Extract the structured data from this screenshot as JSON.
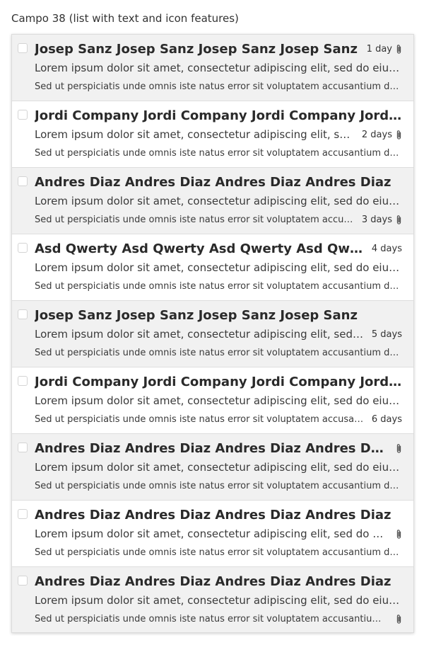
{
  "field": {
    "label": "Campo 38 (list with text and icon features)"
  },
  "icons": {
    "checkbox": "checkbox-icon",
    "attachment": "paperclip-icon"
  },
  "colors": {
    "shaded_row": "#f1f1f1",
    "plain_row": "#ffffff",
    "border": "#dcdcdc"
  },
  "items": [
    {
      "name": "Josep Sanz Josep Sanz Josep Sanz Josep Sanz",
      "text1": "Lorem ipsum dolor sit amet, consectetur adipiscing elit, sed do eiusmod tempor incididunt ut labore",
      "text2": "Sed ut perspiciatis unde omnis iste natus error sit voluptatem accusantium doloremque laudantium",
      "date": "1 day",
      "attachment": true,
      "meta_row": 1,
      "shaded": true
    },
    {
      "name": "Jordi Company Jordi Company Jordi Company Jordi Company",
      "text1": "Lorem ipsum dolor sit amet, consectetur adipiscing elit, sed do eiusmod tempor incididunt ut labore",
      "text2": "Sed ut perspiciatis unde omnis iste natus error sit voluptatem accusantium doloremque laudantium",
      "date": "2 days",
      "attachment": true,
      "meta_row": 2,
      "shaded": false
    },
    {
      "name": "Andres Diaz Andres Diaz Andres Diaz Andres Diaz",
      "text1": "Lorem ipsum dolor sit amet, consectetur adipiscing elit, sed do eiusmod tempor incididunt ut labore",
      "text2": "Sed ut perspiciatis unde omnis iste natus error sit voluptatem accusantium doloremque laudantium",
      "date": "3 days",
      "attachment": true,
      "meta_row": 3,
      "shaded": true
    },
    {
      "name": "Asd Qwerty Asd Qwerty Asd Qwerty Asd Qwerty",
      "text1": "Lorem ipsum dolor sit amet, consectetur adipiscing elit, sed do eiusmod tempor incididunt ut labore",
      "text2": "Sed ut perspiciatis unde omnis iste natus error sit voluptatem accusantium doloremque laudantium",
      "date": "4 days",
      "attachment": false,
      "meta_row": 1,
      "shaded": false
    },
    {
      "name": "Josep Sanz Josep Sanz Josep Sanz Josep Sanz",
      "text1": "Lorem ipsum dolor sit amet, consectetur adipiscing elit, sed do eiusmod tempor incididunt ut labore",
      "text2": "Sed ut perspiciatis unde omnis iste natus error sit voluptatem accusantium doloremque laudantium",
      "date": "5 days",
      "attachment": false,
      "meta_row": 2,
      "shaded": true
    },
    {
      "name": "Jordi Company Jordi Company Jordi Company Jordi Company",
      "text1": "Lorem ipsum dolor sit amet, consectetur adipiscing elit, sed do eiusmod tempor incididunt ut labore",
      "text2": "Sed ut perspiciatis unde omnis iste natus error sit voluptatem accusantium doloremque laudantium",
      "date": "6 days",
      "attachment": false,
      "meta_row": 3,
      "shaded": false
    },
    {
      "name": "Andres Diaz Andres Diaz Andres Diaz Andres Diaz",
      "text1": "Lorem ipsum dolor sit amet, consectetur adipiscing elit, sed do eiusmod tempor incididunt ut labore",
      "text2": "Sed ut perspiciatis unde omnis iste natus error sit voluptatem accusantium doloremque laudantium",
      "date": "",
      "attachment": true,
      "meta_row": 1,
      "shaded": true
    },
    {
      "name": "Andres Diaz Andres Diaz Andres Diaz Andres Diaz",
      "text1": "Lorem ipsum dolor sit amet, consectetur adipiscing elit, sed do eiusmod tempor incididunt ut labore",
      "text2": "Sed ut perspiciatis unde omnis iste natus error sit voluptatem accusantium doloremque laudantium",
      "date": "",
      "attachment": true,
      "meta_row": 2,
      "shaded": false
    },
    {
      "name": "Andres Diaz Andres Diaz Andres Diaz Andres Diaz",
      "text1": "Lorem ipsum dolor sit amet, consectetur adipiscing elit, sed do eiusmod tempor incididunt ut labore",
      "text2": "Sed ut perspiciatis unde omnis iste natus error sit voluptatem accusantium doloremque laudantium",
      "date": "",
      "attachment": true,
      "meta_row": 3,
      "shaded": true
    }
  ]
}
